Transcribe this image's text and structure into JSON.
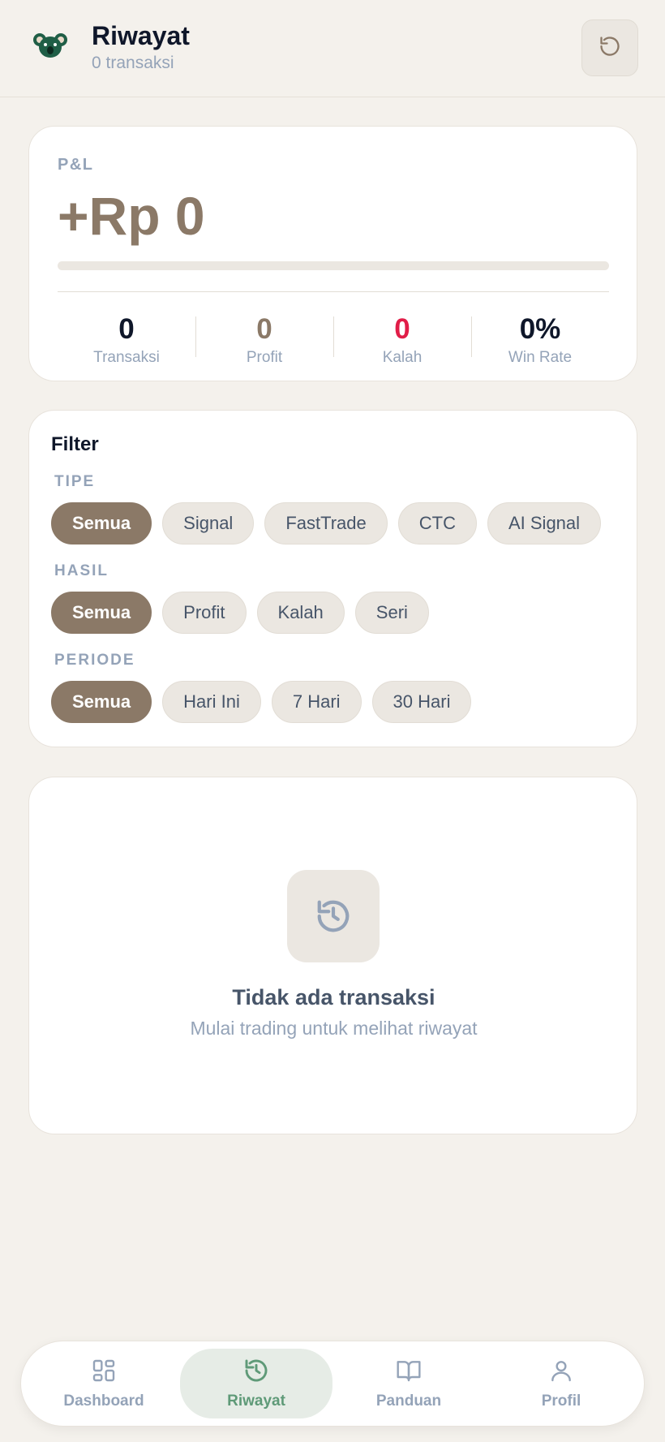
{
  "header": {
    "title": "Riwayat",
    "subtitle": "0 transaksi",
    "logo_icon": "koala-icon",
    "refresh_icon": "refresh-icon"
  },
  "pl": {
    "label": "P&L",
    "value": "+Rp 0",
    "progress": 0,
    "stats": [
      {
        "value": "0",
        "label": "Transaksi",
        "color": "#0f172a"
      },
      {
        "value": "0",
        "label": "Profit",
        "color": "#8b7967"
      },
      {
        "value": "0",
        "label": "Kalah",
        "color": "#e11d48"
      },
      {
        "value": "0%",
        "label": "Win Rate",
        "color": "#0f172a"
      }
    ]
  },
  "filter": {
    "title": "Filter",
    "groups": [
      {
        "label": "TIPE",
        "options": [
          "Semua",
          "Signal",
          "FastTrade",
          "CTC",
          "AI Signal"
        ],
        "selected": "Semua"
      },
      {
        "label": "HASIL",
        "options": [
          "Semua",
          "Profit",
          "Kalah",
          "Seri"
        ],
        "selected": "Semua"
      },
      {
        "label": "PERIODE",
        "options": [
          "Semua",
          "Hari Ini",
          "7 Hari",
          "30 Hari"
        ],
        "selected": "Semua"
      }
    ]
  },
  "empty": {
    "icon": "history-icon",
    "title": "Tidak ada transaksi",
    "subtitle": "Mulai trading untuk melihat riwayat"
  },
  "nav": {
    "items": [
      {
        "label": "Dashboard",
        "icon": "dashboard-icon",
        "active": false
      },
      {
        "label": "Riwayat",
        "icon": "history-icon",
        "active": true
      },
      {
        "label": "Panduan",
        "icon": "book-icon",
        "active": false
      },
      {
        "label": "Profil",
        "icon": "user-icon",
        "active": false
      }
    ]
  },
  "colors": {
    "accent": "#8b7967",
    "nav_active": "#5f9a78",
    "loss": "#e11d48",
    "muted": "#94a3b8"
  }
}
